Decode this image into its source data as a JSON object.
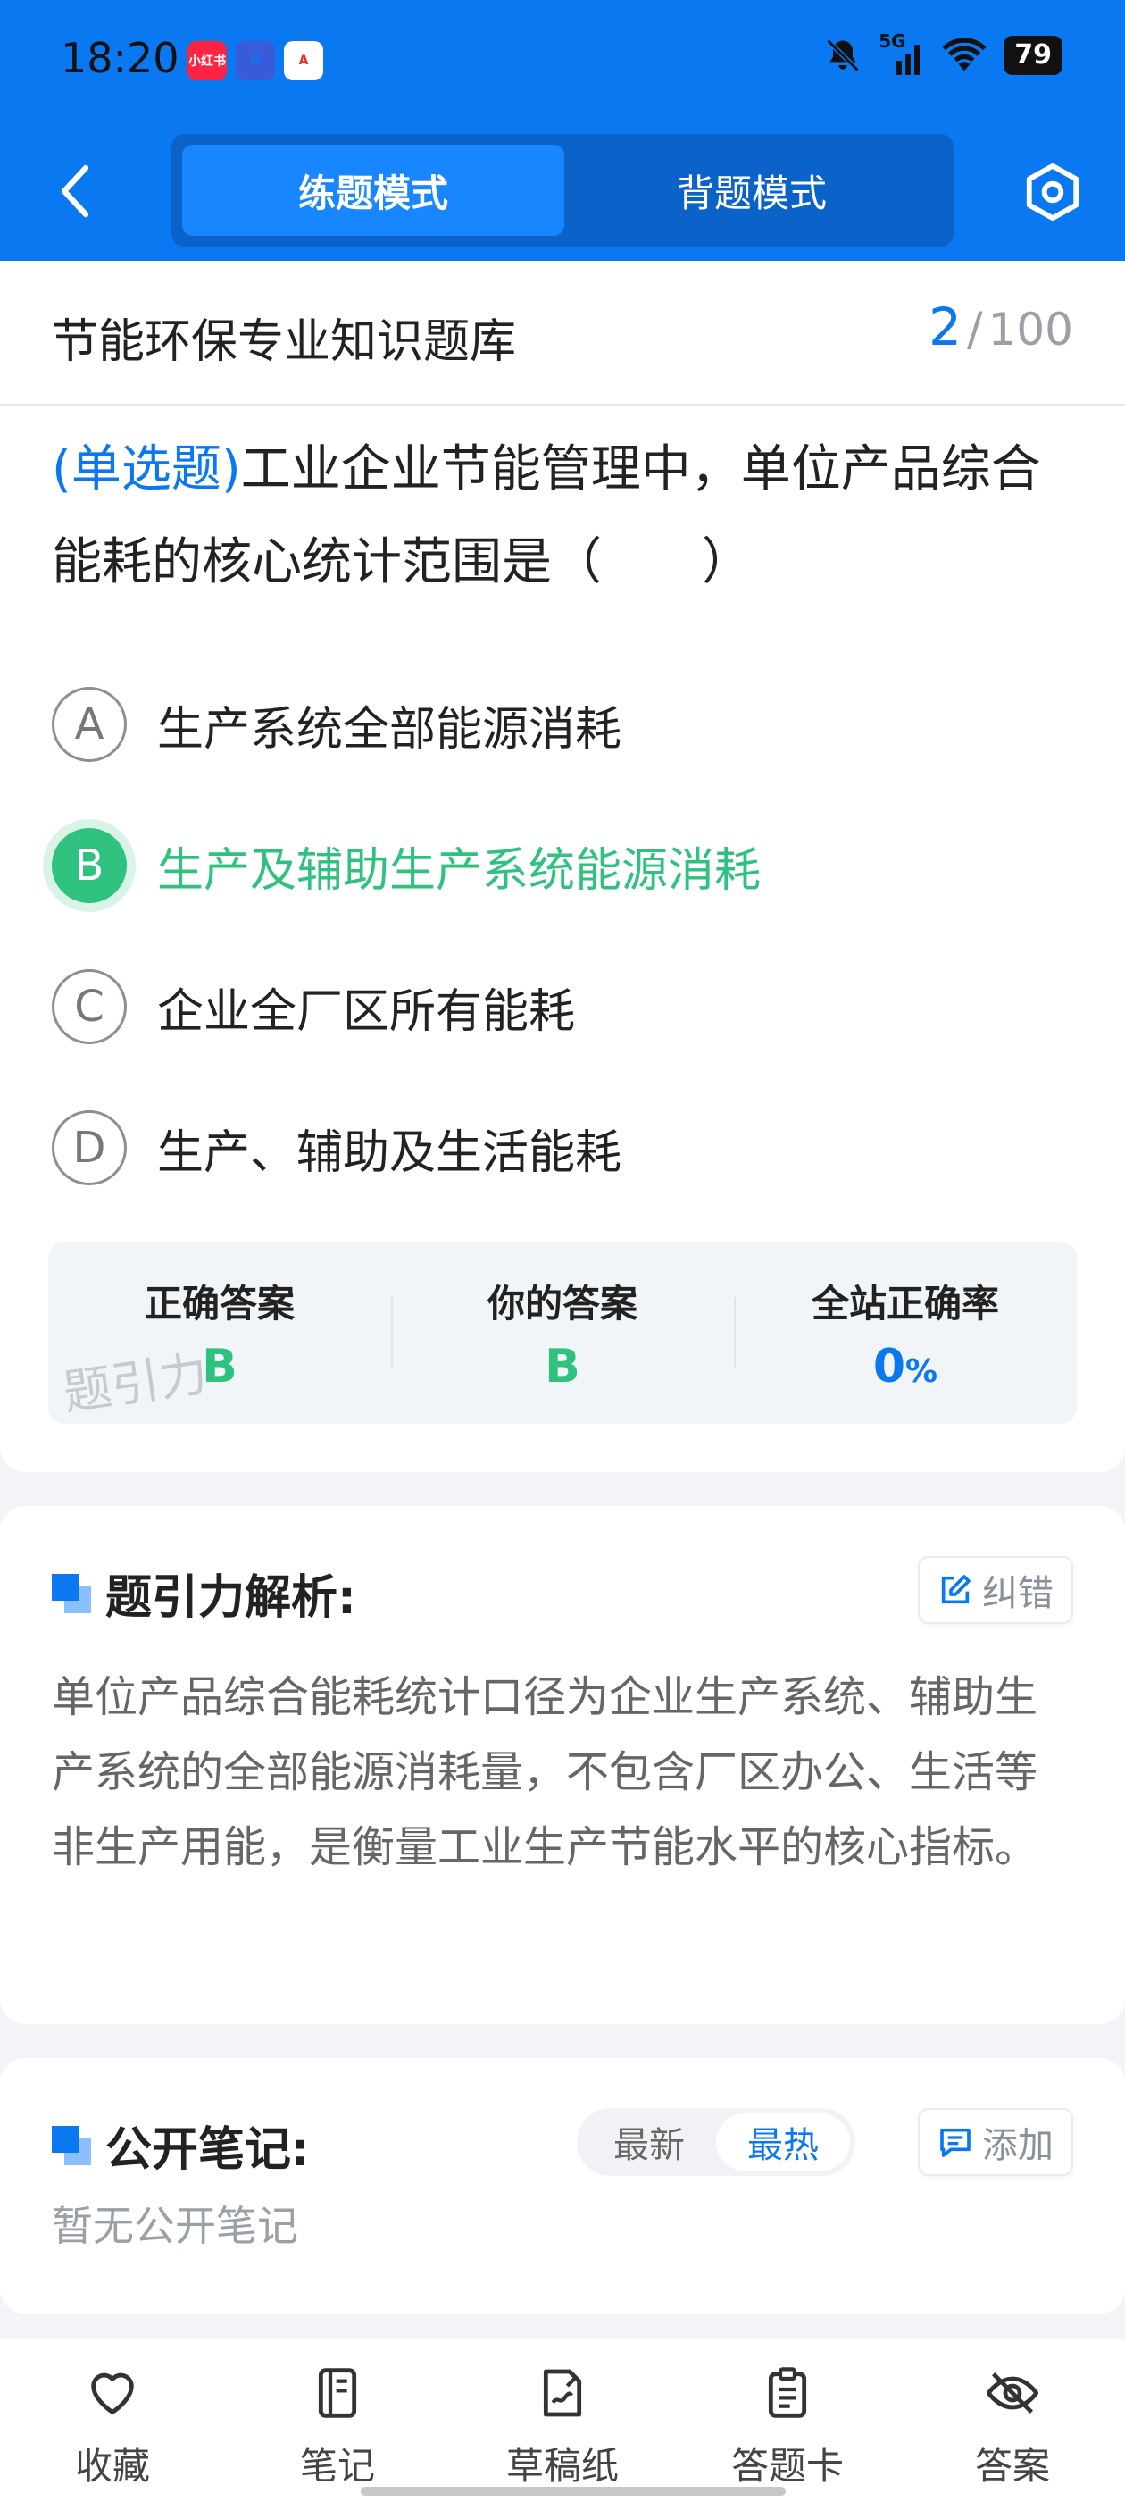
{
  "status_bar": {
    "time": "18:20",
    "apps": [
      "小红书",
      "U",
      "A"
    ],
    "network": "5G",
    "battery": "79"
  },
  "nav": {
    "tabs": [
      {
        "label": "练题模式",
        "active": true
      },
      {
        "label": "背题模式",
        "active": false
      }
    ]
  },
  "bank": {
    "title": "节能环保专业知识题库",
    "current": "2",
    "separator": "/",
    "total": "100"
  },
  "question": {
    "type": "(单选题)",
    "text": "工业企业节能管理中，单位产品综合能耗的核心统计范围是（　　）"
  },
  "options": [
    {
      "letter": "A",
      "text": "生产系统全部能源消耗"
    },
    {
      "letter": "B",
      "text": "生产及辅助生产系统能源消耗"
    },
    {
      "letter": "C",
      "text": "企业全厂区所有能耗"
    },
    {
      "letter": "D",
      "text": "生产、辅助及生活能耗"
    }
  ],
  "selected_option": "B",
  "answers": {
    "correct_label": "正确答案",
    "correct_value": "B",
    "yours_label": "你的答案",
    "yours_value": "B",
    "rate_label": "全站正确率",
    "rate_value": "0",
    "rate_unit": "%",
    "watermark": "题引力"
  },
  "analysis": {
    "title": "题引力解析:",
    "correct_button": "纠错",
    "text": "单位产品综合能耗统计口径为企业生产系统、辅助生产系统的全部能源消耗量，不包含厂区办公、生活等非生产用能，是衡量工业生产节能水平的核心指标。"
  },
  "notes": {
    "title": "公开笔记:",
    "sort_newest": "最新",
    "sort_hottest": "最热",
    "add_button": "添加",
    "empty_text": "暂无公开笔记"
  },
  "bottom_tabs": [
    {
      "label": "收藏",
      "icon": "heart-icon"
    },
    {
      "label": "笔记",
      "icon": "notebook-icon"
    },
    {
      "label": "草稿纸",
      "icon": "draft-paper-icon"
    },
    {
      "label": "答题卡",
      "icon": "clipboard-icon"
    },
    {
      "label": "答案",
      "icon": "eye-off-icon"
    }
  ],
  "colors": {
    "primary": "#0a78f0",
    "correct": "#2ec27e"
  }
}
